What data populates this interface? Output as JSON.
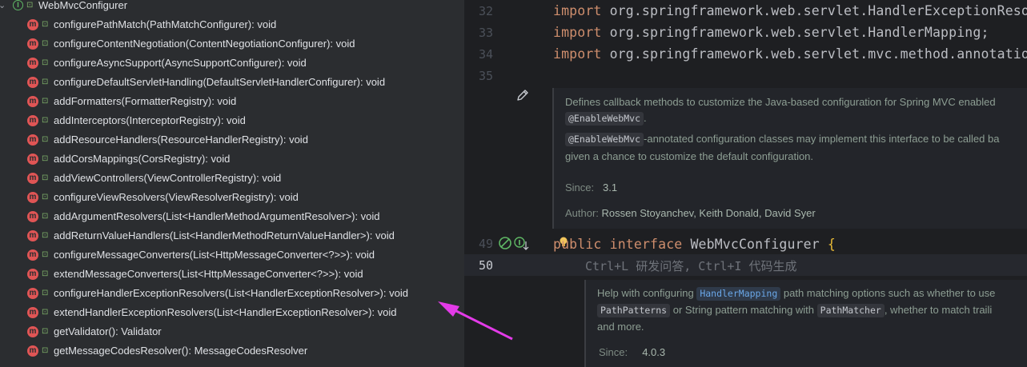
{
  "structure": {
    "root": {
      "label": "WebMvcConfigurer"
    },
    "methods": [
      "configurePathMatch(PathMatchConfigurer): void",
      "configureContentNegotiation(ContentNegotiationConfigurer): void",
      "configureAsyncSupport(AsyncSupportConfigurer): void",
      "configureDefaultServletHandling(DefaultServletHandlerConfigurer): void",
      "addFormatters(FormatterRegistry): void",
      "addInterceptors(InterceptorRegistry): void",
      "addResourceHandlers(ResourceHandlerRegistry): void",
      "addCorsMappings(CorsRegistry): void",
      "addViewControllers(ViewControllerRegistry): void",
      "configureViewResolvers(ViewResolverRegistry): void",
      "addArgumentResolvers(List<HandlerMethodArgumentResolver>): void",
      "addReturnValueHandlers(List<HandlerMethodReturnValueHandler>): void",
      "configureMessageConverters(List<HttpMessageConverter<?>>): void",
      "extendMessageConverters(List<HttpMessageConverter<?>>): void",
      "configureHandlerExceptionResolvers(List<HandlerExceptionResolver>): void",
      "extendHandlerExceptionResolvers(List<HandlerExceptionResolver>): void",
      "getValidator(): Validator",
      "getMessageCodesResolver(): MessageCodesResolver"
    ],
    "badge_letters": {
      "interface": "I",
      "method": "m"
    }
  },
  "editor": {
    "lines": {
      "n32": "32",
      "n33": "33",
      "n34": "34",
      "n35": "35",
      "n49": "49",
      "n50": "50"
    },
    "imports": {
      "keyword": "import",
      "l32": " org.springframework.web.servlet.HandlerExceptionReso",
      "l33": " org.springframework.web.servlet.HandlerMapping;",
      "l34": " org.springframework.web.servlet.mvc.method.annotatio"
    },
    "doc1": {
      "line1": "Defines callback methods to customize the Java-based configuration for Spring MVC enabled",
      "chip1": "@EnableWebMvc",
      "after_chip1": ".",
      "chip2": "@EnableWebMvc",
      "line3_rest": "-annotated configuration classes may implement this interface to be called ba",
      "line4": "given a chance to customize the default configuration.",
      "since_label": "Since:",
      "since_value": "3.1",
      "author_label": "Author:",
      "author_value": "Rossen Stoyanchev, Keith Donald, David Syer"
    },
    "decl": {
      "kw_public": "public",
      "kw_interface": "interface",
      "name": "WebMvcConfigurer",
      "brace": "{"
    },
    "hint": "Ctrl+L 研发问答, Ctrl+I 代码生成",
    "doc2": {
      "l1_a": "Help with configuring",
      "chip_mapping": "HandlerMapping",
      "l1_b": "path matching options such as whether to use",
      "chip_patterns": "PathPatterns",
      "l2_a": "or String pattern matching with",
      "chip_matcher": "PathMatcher",
      "l2_b": ", whether to match traili",
      "l3": "and more.",
      "since_label": "Since:",
      "since_value": "4.0.3"
    }
  },
  "colors": {
    "annotation_arrow": "#e33be8",
    "keyword": "#cf8e6d",
    "method_badge": "#e05555",
    "interface_badge": "#5fb865"
  }
}
